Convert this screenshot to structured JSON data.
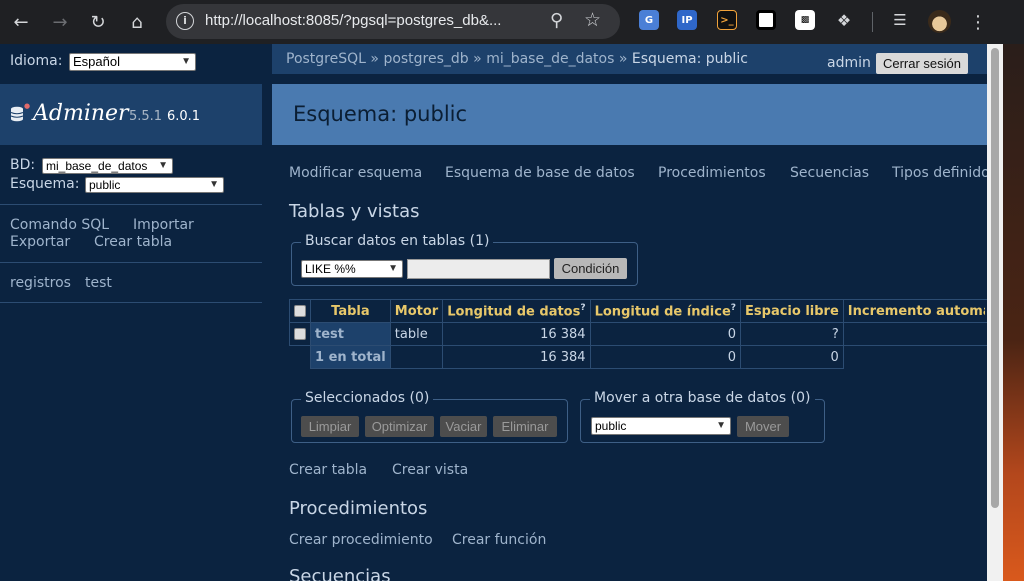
{
  "browser": {
    "url": "http://localhost:8085/?pgsql=postgres_db&..."
  },
  "sidebar": {
    "language_label": "Idioma:",
    "language_value": "Español",
    "logo_name": "Adminer",
    "version_old": "5.5.1",
    "version_new": "6.0.1",
    "db_label": "BD:",
    "db_value": "mi_base_de_datos",
    "schema_label": "Esquema:",
    "schema_value": "public",
    "links": [
      "Comando SQL",
      "Importar",
      "Exportar",
      "Crear tabla"
    ],
    "tables": [
      "registros",
      "test"
    ]
  },
  "header": {
    "breadcrumb": [
      "PostgreSQL",
      "postgres_db",
      "mi_base_de_datos"
    ],
    "breadcrumb_sep": "»",
    "breadcrumb_current": "Esquema: public",
    "user": "admin",
    "logout_label": "Cerrar sesión",
    "title": "Esquema: public"
  },
  "main": {
    "nav_links": [
      "Modificar esquema",
      "Esquema de base de datos",
      "Procedimientos",
      "Secuencias",
      "Tipos definidos"
    ],
    "tables_heading": "Tablas y vistas",
    "search": {
      "legend": "Buscar datos en tablas (1)",
      "operator": "LIKE %%",
      "value": "",
      "button": "Condición"
    },
    "table": {
      "headers": [
        "Tabla",
        "Motor",
        "Longitud de datos",
        "Longitud de índice",
        "Espacio libre",
        "Incremento automático"
      ],
      "help_mark": "?",
      "rows": [
        {
          "name": "test",
          "engine": "table",
          "data_length": "16 384",
          "index_length": "0",
          "free": "?",
          "auto_inc": ""
        }
      ],
      "total": {
        "label": "1 en total",
        "data_length": "16 384",
        "index_length": "0",
        "free": "0"
      }
    },
    "selected": {
      "legend": "Seleccionados (0)",
      "buttons": [
        "Limpiar",
        "Optimizar",
        "Vaciar",
        "Eliminar"
      ]
    },
    "move": {
      "legend": "Mover a otra base de datos (0)",
      "target": "public",
      "button": "Mover"
    },
    "create_links": [
      "Crear tabla",
      "Crear vista"
    ],
    "procedures_heading": "Procedimientos",
    "procedure_links": [
      "Crear procedimiento",
      "Crear función"
    ],
    "sequences_heading": "Secuencias"
  }
}
